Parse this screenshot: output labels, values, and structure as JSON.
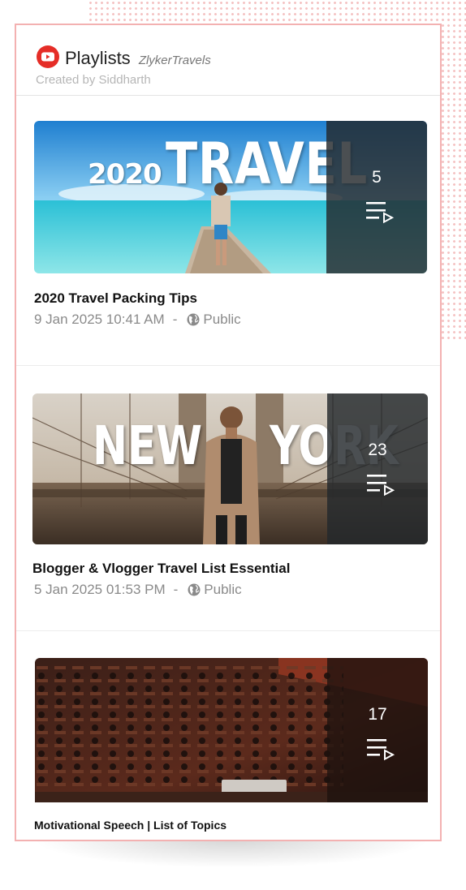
{
  "header": {
    "title": "Playlists",
    "channel": "ZlykerTravels",
    "subtitle": "Created by Siddharth",
    "icon": "youtube-icon",
    "accent": "#e52d27"
  },
  "playlists": [
    {
      "thumb_text_left": "2020",
      "thumb_text_big": "TRAVEL",
      "count": "5",
      "title": "2020 Travel Packing Tips",
      "date": "9 Jan 2025 10:41 AM",
      "separator": "-",
      "visibility": "Public"
    },
    {
      "thumb_text_left": "NEW",
      "thumb_text_big": "YORK",
      "count": "23",
      "title": "Blogger & Vlogger Travel List Essential",
      "date": "5 Jan 2025 01:53 PM",
      "separator": "-",
      "visibility": "Public"
    },
    {
      "count": "17",
      "title": "Motivational Speech | List of Topics"
    }
  ],
  "icons": {
    "playlist": "playlist-icon",
    "visibility": "globe-icon"
  },
  "colors": {
    "card_border": "#f3b1b1",
    "dots": "#f4c2c2",
    "overlay": "#23282c"
  }
}
